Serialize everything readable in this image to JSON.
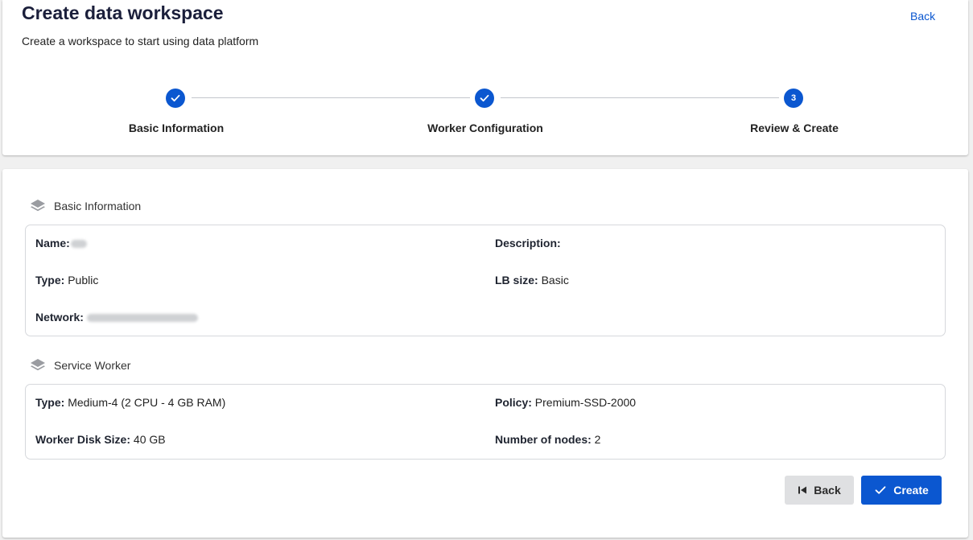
{
  "header": {
    "title": "Create data workspace",
    "subtitle": "Create a workspace to start using data platform",
    "back_label": "Back"
  },
  "stepper": {
    "steps": [
      {
        "label": "Basic Information",
        "status": "completed"
      },
      {
        "label": "Worker Configuration",
        "status": "completed"
      },
      {
        "label": "Review & Create",
        "status": "active",
        "number": "3"
      }
    ]
  },
  "basic_info": {
    "section_title": "Basic Information",
    "name_label": "Name:",
    "description_label": "Description:",
    "type_label": "Type:",
    "type_value": "Public",
    "lb_size_label": "LB size:",
    "lb_size_value": "Basic",
    "network_label": "Network:"
  },
  "service_worker": {
    "section_title": "Service Worker",
    "type_label": "Type:",
    "type_value": "Medium-4 (2 CPU - 4 GB RAM)",
    "policy_label": "Policy:",
    "policy_value": "Premium-SSD-2000",
    "disk_label": "Worker Disk Size:",
    "disk_value": "40 GB",
    "nodes_label": "Number of nodes:",
    "nodes_value": "2"
  },
  "actions": {
    "back_label": "Back",
    "create_label": "Create"
  },
  "icons": {
    "step_done": "check-icon",
    "section": "layers-icon",
    "back": "skip-back-icon",
    "create": "check-icon"
  },
  "colors": {
    "primary": "#0b57d0",
    "secondary_button": "#dfe0e2",
    "background": "#f0f0f0"
  }
}
